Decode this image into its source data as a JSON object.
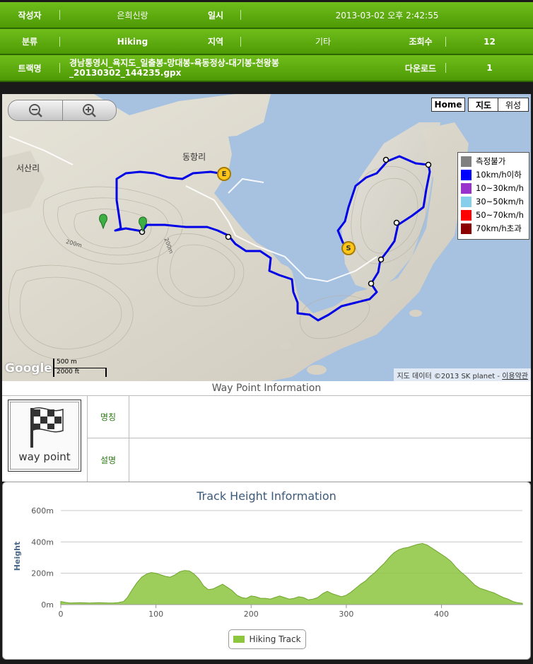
{
  "info": {
    "row1": {
      "author_label": "작성자",
      "author_value": "은희신랑",
      "date_label": "일시",
      "date_value": "2013-03-02 오후 2:42:55"
    },
    "row2": {
      "category_label": "분류",
      "category_value": "Hiking",
      "region_label": "지역",
      "region_value": "기타",
      "views_label": "조회수",
      "views_value": "12"
    },
    "row3": {
      "track_label": "트랙명",
      "track_value_line1": "경남통영시_욕지도_일출봉-망대봉-욕동정상-대기봉-천왕봉",
      "track_value_line2": "_20130302_144235.gpx",
      "download_label": "다운로드",
      "download_value": "1"
    }
  },
  "map": {
    "zoom_out_icon": "zoom-out-icon",
    "zoom_in_icon": "zoom-in-icon",
    "type_home": "Home",
    "type_map": "지도",
    "type_satellite": "위성",
    "place_labels": {
      "dongyang": "동항리",
      "seosan": "서산리",
      "elev1": "200m",
      "elev2": "200m"
    },
    "markers": {
      "start": "S",
      "end": "E"
    },
    "legend": [
      {
        "label": "측정불가",
        "color": "#808080"
      },
      {
        "label": "10km/h이하",
        "color": "#0000ff"
      },
      {
        "label": "10~30km/h",
        "color": "#9932cc"
      },
      {
        "label": "30~50km/h",
        "color": "#87ceeb"
      },
      {
        "label": "50~70km/h",
        "color": "#ff0000"
      },
      {
        "label": "70km/h초과",
        "color": "#8b0000"
      }
    ],
    "scale_metric": "500 m",
    "scale_imperial": "2000 ft",
    "google_logo": "Google",
    "attribution": "지도 데이터 ©2013 SK planet -",
    "terms_link": "이용약관"
  },
  "waypoint": {
    "title": "Way Point Information",
    "icon_label": "way point",
    "name_label": "명칭",
    "name_value": "",
    "desc_label": "설명",
    "desc_value": ""
  },
  "chart_data": {
    "type": "area",
    "title": "Track Height Information",
    "xlabel": "",
    "ylabel": "Height",
    "ytick_labels": [
      "0m",
      "200m",
      "400m",
      "600m"
    ],
    "xtick_labels": [
      "0",
      "100",
      "200",
      "300",
      "400"
    ],
    "xlim": [
      0,
      485
    ],
    "ylim": [
      0,
      600
    ],
    "legend_position": "bottom",
    "color": "#8cc63f",
    "series": [
      {
        "name": "Hiking Track",
        "x": [
          0,
          5,
          10,
          20,
          30,
          40,
          50,
          55,
          60,
          66,
          70,
          75,
          80,
          85,
          90,
          95,
          100,
          105,
          110,
          115,
          120,
          125,
          130,
          135,
          140,
          145,
          150,
          155,
          160,
          165,
          170,
          175,
          180,
          185,
          190,
          195,
          200,
          205,
          210,
          215,
          220,
          225,
          230,
          235,
          240,
          245,
          250,
          255,
          260,
          265,
          270,
          275,
          280,
          285,
          290,
          295,
          300,
          305,
          310,
          315,
          320,
          325,
          330,
          335,
          340,
          345,
          350,
          355,
          360,
          365,
          370,
          375,
          380,
          385,
          390,
          395,
          400,
          405,
          410,
          415,
          420,
          425,
          430,
          435,
          440,
          445,
          450,
          455,
          460,
          465,
          470,
          475,
          480,
          485
        ],
        "y": [
          20,
          14,
          10,
          12,
          10,
          12,
          10,
          10,
          12,
          20,
          45,
          95,
          140,
          175,
          195,
          205,
          200,
          190,
          180,
          175,
          190,
          210,
          218,
          215,
          195,
          165,
          120,
          95,
          100,
          115,
          130,
          110,
          90,
          60,
          45,
          40,
          55,
          50,
          40,
          40,
          35,
          45,
          55,
          45,
          35,
          40,
          50,
          45,
          30,
          35,
          45,
          70,
          85,
          70,
          60,
          50,
          60,
          80,
          105,
          130,
          150,
          180,
          205,
          235,
          265,
          300,
          330,
          350,
          360,
          365,
          375,
          385,
          390,
          380,
          360,
          340,
          320,
          300,
          275,
          240,
          210,
          185,
          155,
          125,
          105,
          95,
          85,
          75,
          60,
          45,
          35,
          20,
          12,
          8
        ]
      }
    ]
  }
}
